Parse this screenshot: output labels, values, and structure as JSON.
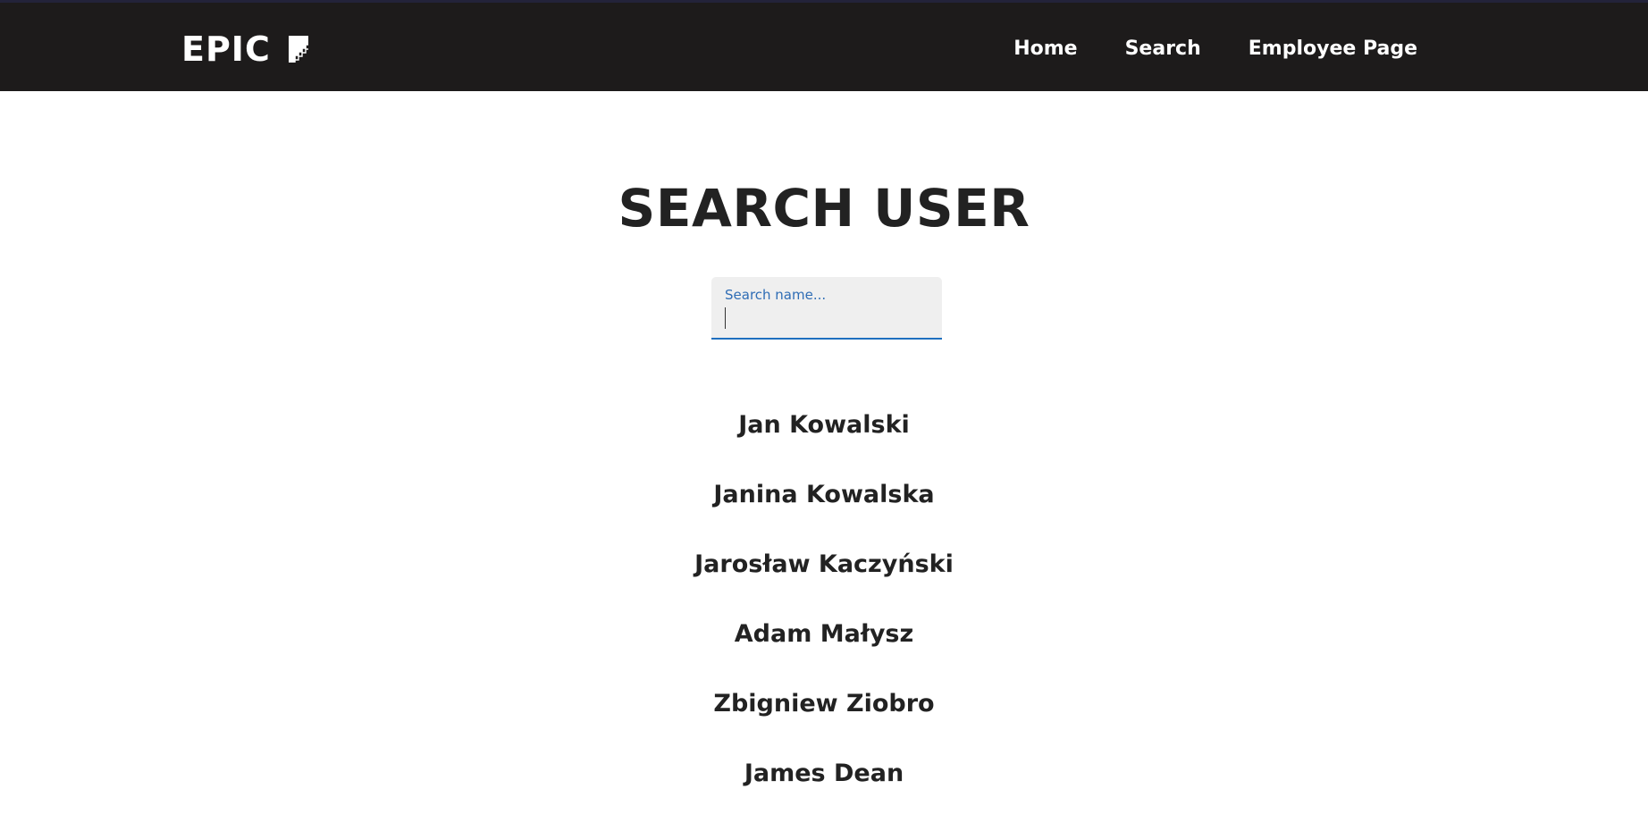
{
  "header": {
    "brand": "EPIC",
    "logo_icon": "epic-stairs-logo-icon",
    "nav": [
      {
        "label": "Home"
      },
      {
        "label": "Search"
      },
      {
        "label": "Employee Page"
      }
    ]
  },
  "main": {
    "title": "SEARCH USER",
    "search": {
      "label": "Search name...",
      "value": ""
    },
    "results": [
      {
        "name": "Jan Kowalski"
      },
      {
        "name": "Janina Kowalska"
      },
      {
        "name": "Jarosław Kaczyński"
      },
      {
        "name": "Adam Małysz"
      },
      {
        "name": "Zbigniew Ziobro"
      },
      {
        "name": "James Dean"
      }
    ]
  },
  "colors": {
    "header_bg": "#1d1b1b",
    "header_text": "#ffffff",
    "title_text": "#222222",
    "field_bg": "#efefef",
    "field_accent": "#1f6fbf"
  }
}
